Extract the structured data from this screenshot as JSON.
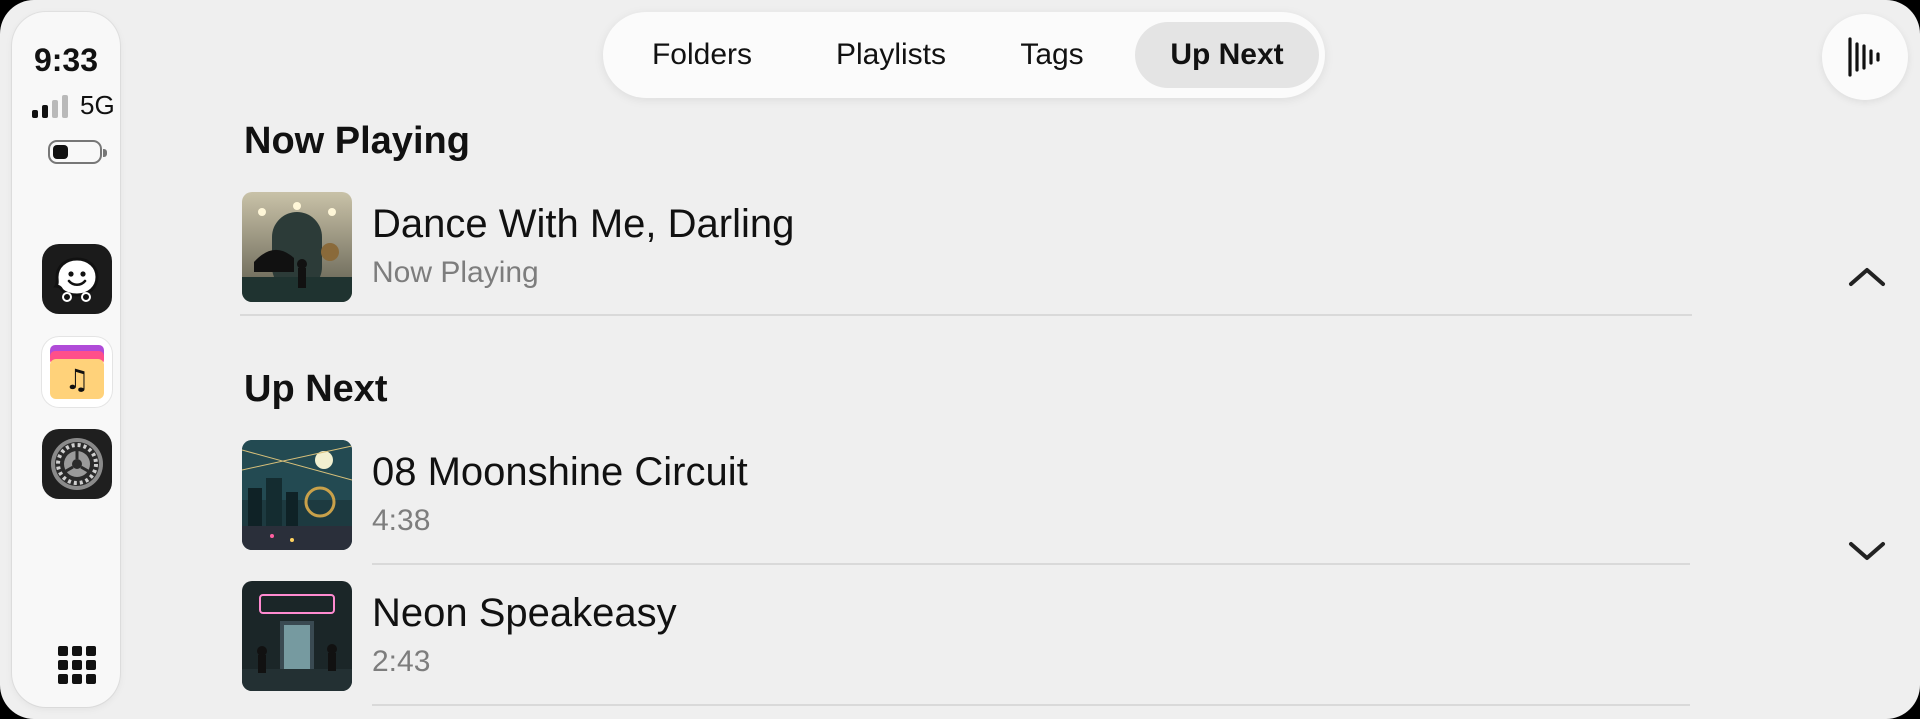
{
  "status": {
    "time": "9:33",
    "network": "5G"
  },
  "dock": {
    "apps": [
      {
        "name": "waze-app-icon"
      },
      {
        "name": "music-folder-app-icon"
      },
      {
        "name": "settings-app-icon"
      }
    ]
  },
  "tabs": [
    {
      "label": "Folders",
      "active": false
    },
    {
      "label": "Playlists",
      "active": false
    },
    {
      "label": "Tags",
      "active": false
    },
    {
      "label": "Up Next",
      "active": true
    }
  ],
  "now_playing": {
    "heading": "Now Playing",
    "track": {
      "title": "Dance With Me, Darling",
      "subtitle": "Now Playing"
    }
  },
  "up_next": {
    "heading": "Up Next",
    "tracks": [
      {
        "title": "08 Moonshine Circuit",
        "duration": "4:38"
      },
      {
        "title": "Neon Speakeasy",
        "duration": "2:43"
      }
    ]
  },
  "colors": {
    "background": "#efefef",
    "dock": "#f8f8f8",
    "active_tab": "#e4e4e4",
    "subtitle": "#7d7d7d"
  }
}
